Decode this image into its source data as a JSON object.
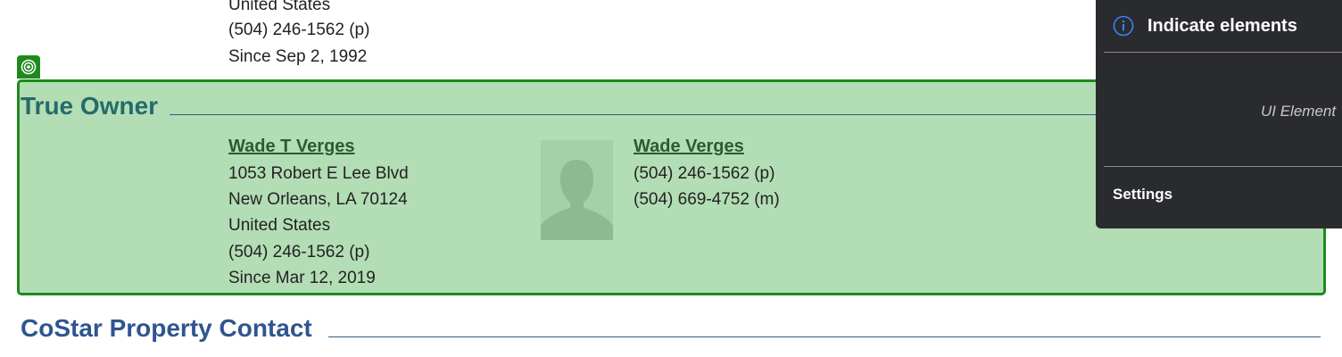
{
  "previous_contact": {
    "lines": [
      "United States",
      "(504) 246-1562 (p)",
      "Since Sep 2, 1992"
    ]
  },
  "true_owner": {
    "heading": "True Owner",
    "company": {
      "name": "Wade T Verges",
      "address": [
        "1053 Robert E Lee Blvd",
        "New Orleans, LA 70124",
        "United States"
      ],
      "phone": "(504) 246-1562 (p)",
      "since": "Since Mar 12, 2019"
    },
    "person": {
      "name": "Wade Verges",
      "phones": [
        "(504) 246-1562 (p)",
        "(504) 669-4752 (m)"
      ]
    },
    "highlight_color": "#1e8a1e",
    "background_color": "#b3ddb5"
  },
  "costar_contact": {
    "heading": "CoStar Property Contact"
  },
  "panel": {
    "title": "Indicate elements",
    "element_label": "UI Element",
    "settings": "Settings"
  },
  "icons": {
    "target": "target-icon",
    "info": "info-icon",
    "avatar": "person-silhouette-icon"
  }
}
